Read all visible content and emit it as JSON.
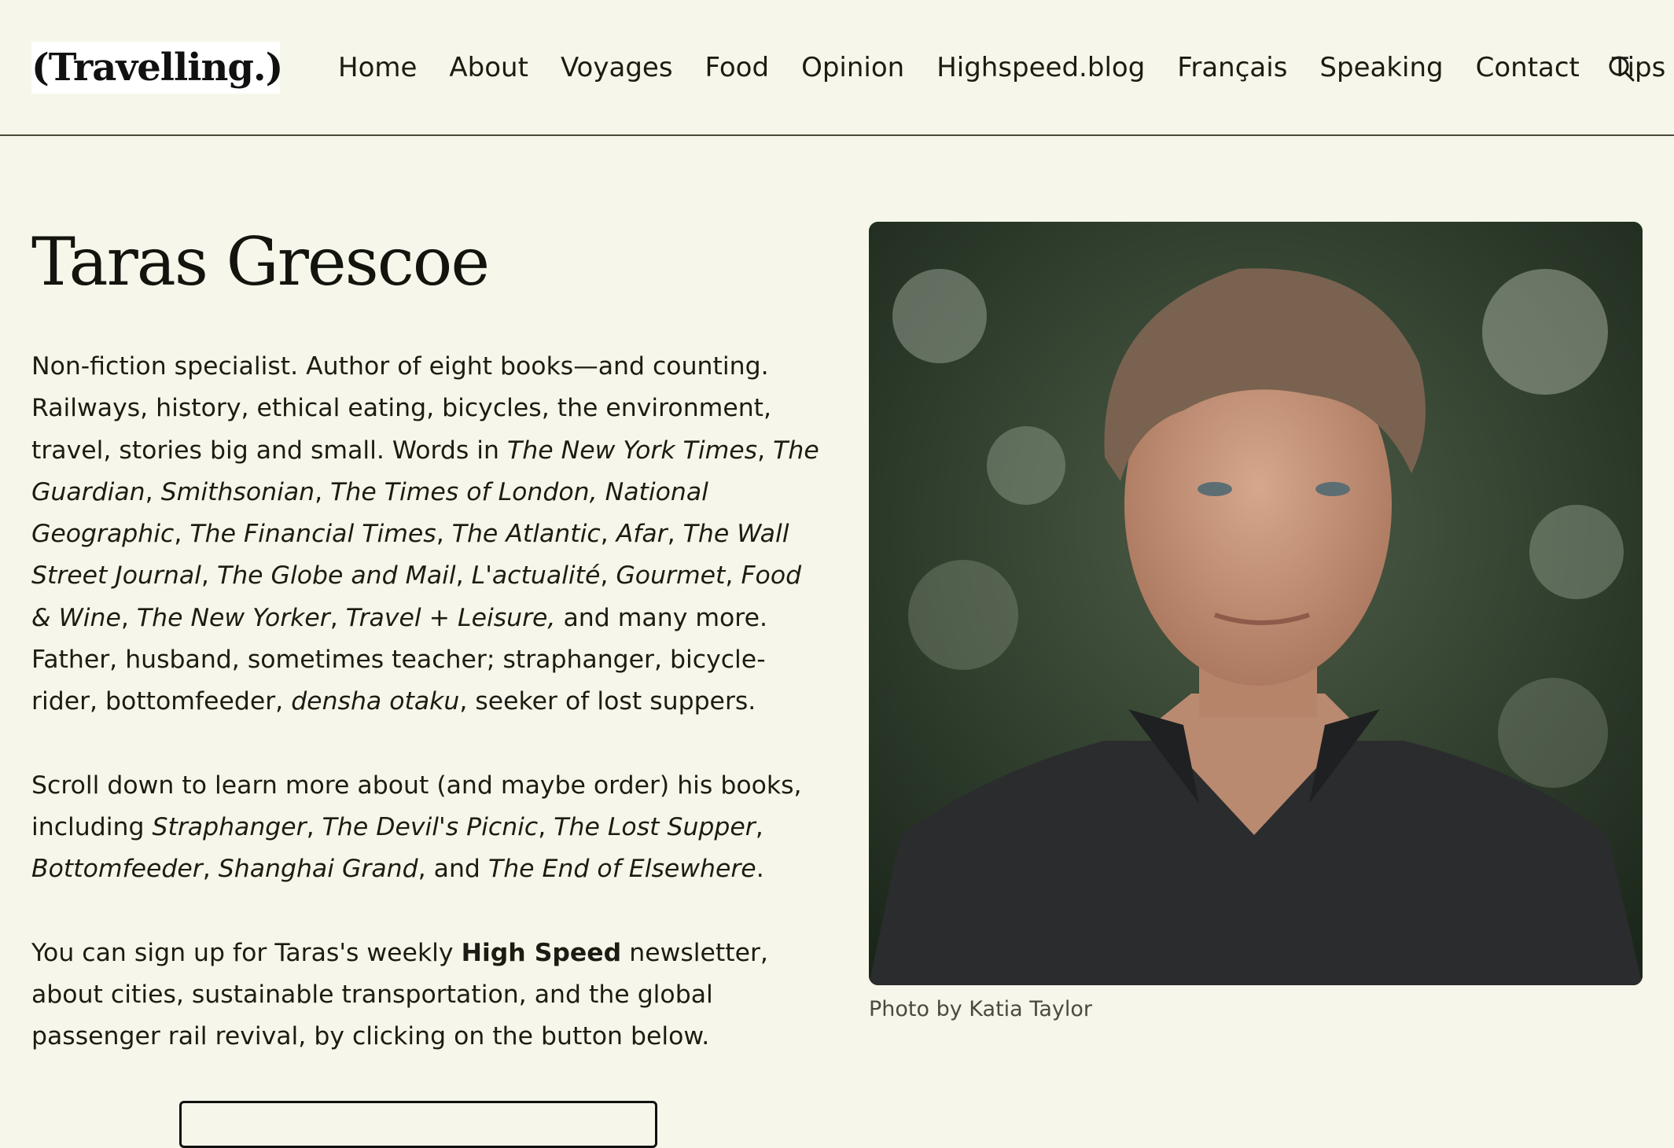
{
  "header": {
    "logo": "(Travelling.)",
    "nav": [
      "Home",
      "About",
      "Voyages",
      "Food",
      "Opinion",
      "Highspeed.blog",
      "Français",
      "Speaking",
      "Contact",
      "Tips"
    ],
    "search_icon": "search-icon"
  },
  "main": {
    "title": "Taras Grescoe",
    "bio1": [
      {
        "t": "Non-fiction specialist. Author of eight books—and counting. Railways, history, ethical eating, bicycles, the environment, travel, stories big and small. Words in "
      },
      {
        "t": "The New York Times",
        "i": true
      },
      {
        "t": ", "
      },
      {
        "t": "The Guardian",
        "i": true
      },
      {
        "t": ", "
      },
      {
        "t": "Smithsonian",
        "i": true
      },
      {
        "t": ", "
      },
      {
        "t": "The Times of London, National Geographic",
        "i": true
      },
      {
        "t": ", "
      },
      {
        "t": "The Financial Times",
        "i": true
      },
      {
        "t": ", "
      },
      {
        "t": "The Atlantic",
        "i": true
      },
      {
        "t": ", "
      },
      {
        "t": "Afar",
        "i": true
      },
      {
        "t": ", "
      },
      {
        "t": "The Wall Street Journal",
        "i": true
      },
      {
        "t": ", "
      },
      {
        "t": "The Globe and Mail",
        "i": true
      },
      {
        "t": ", "
      },
      {
        "t": "L'actualité",
        "i": true
      },
      {
        "t": ", "
      },
      {
        "t": "Gourmet",
        "i": true
      },
      {
        "t": ", "
      },
      {
        "t": "Food & Wine",
        "i": true
      },
      {
        "t": ", "
      },
      {
        "t": "The New Yorker",
        "i": true
      },
      {
        "t": ", "
      },
      {
        "t": "Travel + Leisure,",
        "i": true
      },
      {
        "t": " and many more. Father, husband, sometimes teacher; straphanger, bicycle-rider, bottomfeeder, "
      },
      {
        "t": "densha otaku",
        "i": true
      },
      {
        "t": ", seeker of lost suppers."
      }
    ],
    "bio2": [
      {
        "t": "Scroll down to learn more about (and maybe order) his books, including "
      },
      {
        "t": "Straphanger",
        "i": true
      },
      {
        "t": ", "
      },
      {
        "t": "The Devil's Picnic",
        "i": true
      },
      {
        "t": ", "
      },
      {
        "t": "The Lost Supper",
        "i": true
      },
      {
        "t": ", "
      },
      {
        "t": "Bottomfeeder",
        "i": true
      },
      {
        "t": ", "
      },
      {
        "t": "Shanghai Grand",
        "i": true
      },
      {
        "t": ", and "
      },
      {
        "t": "The End of Elsewhere",
        "i": true
      },
      {
        "t": "."
      }
    ],
    "bio3": [
      {
        "t": "You can sign up for Taras's weekly "
      },
      {
        "t": "High Speed",
        "b": true
      },
      {
        "t": " newsletter, about cities, sustainable transportation, and the global passenger rail revival, by clicking on the button below."
      }
    ],
    "photo_caption": "Photo by Katia Taylor"
  }
}
